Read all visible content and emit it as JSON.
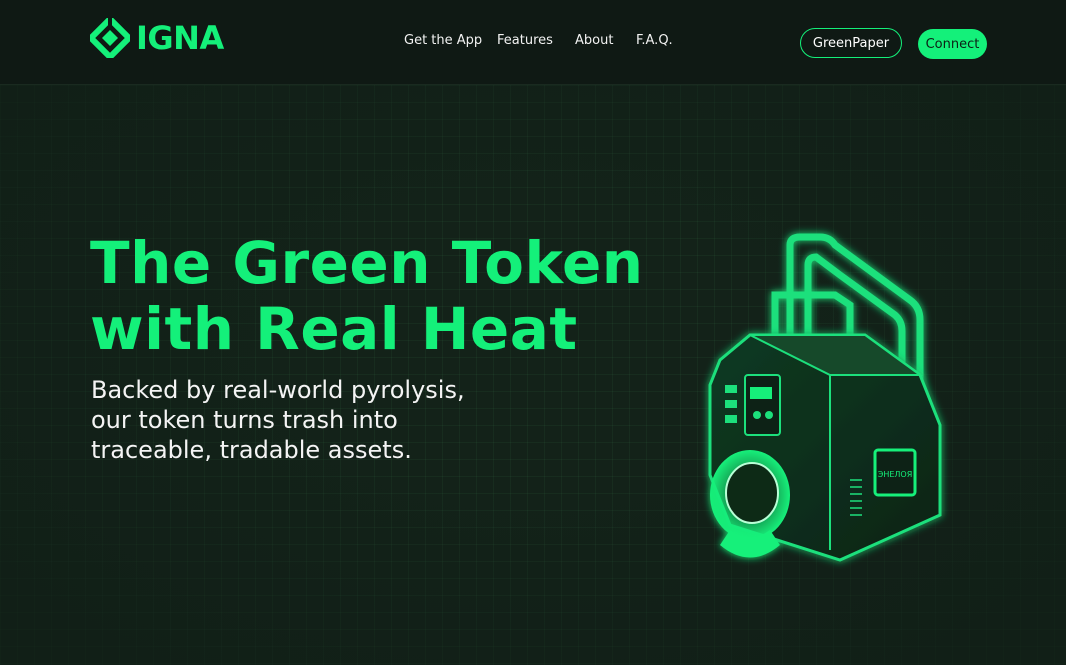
{
  "brand": {
    "name": "IGNA",
    "accent": "#14f07a",
    "background": "#132219"
  },
  "nav": {
    "items": [
      {
        "label": "Get the App"
      },
      {
        "label": "Features"
      },
      {
        "label": "About"
      },
      {
        "label": "F.A.Q."
      }
    ]
  },
  "header_actions": {
    "greenpaper_label": "GreenPaper",
    "connect_label": "Connect"
  },
  "hero": {
    "title_line1": "The Green Token",
    "title_line2": "with Real Heat",
    "subtitle_line1": "Backed by real-world pyrolysis,",
    "subtitle_line2": "our token turns trash into",
    "subtitle_line3": "traceable, tradable assets.",
    "illustration": "neon-pyrolysis-machine-illustration",
    "machine_panel_text": "ЭНЕЛОЯ"
  }
}
